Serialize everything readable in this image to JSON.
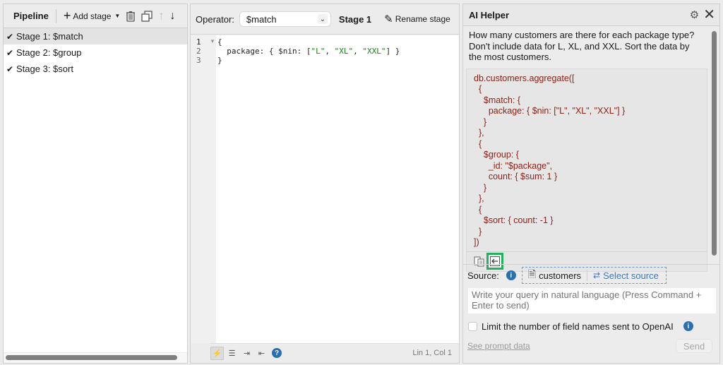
{
  "pipeline": {
    "title": "Pipeline",
    "add_stage_label": "Add stage",
    "stages": [
      {
        "label": "Stage 1: $match",
        "checked": true,
        "selected": true
      },
      {
        "label": "Stage 2: $group",
        "checked": true,
        "selected": false
      },
      {
        "label": "Stage 3: $sort",
        "checked": true,
        "selected": false
      }
    ]
  },
  "editor": {
    "operator_label": "Operator:",
    "operator_value": "$match",
    "stage_name": "Stage 1",
    "rename_label": "Rename stage",
    "line_numbers": [
      "1",
      "2",
      "3"
    ],
    "code_lines": {
      "l1": "{",
      "l2_pre": "  package: { $nin: [",
      "s1": "\"L\"",
      "c1": ", ",
      "s2": "\"XL\"",
      "c2": ", ",
      "s3": "\"XXL\"",
      "l2_post": "] }",
      "l3": "}"
    },
    "cursor_position": "Lin 1, Col 1"
  },
  "ai_helper": {
    "title": "AI Helper",
    "prompt": "How many customers are there for each package type? Don't include data for L, XL, and XXL. Sort the data by the most customers.",
    "response_code": "db.customers.aggregate([\n  {\n    $match: {\n      package: { $nin: [\"L\", \"XL\", \"XXL\"] }\n    }\n  },\n  {\n    $group: {\n      _id: \"$package\",\n      count: { $sum: 1 }\n    }\n  },\n  {\n    $sort: { count: -1 }\n  }\n])",
    "source_label": "Source:",
    "source_collection": "customers",
    "select_source_label": "Select source",
    "query_placeholder": "Write your query in natural language (Press Command + Enter to send)",
    "limit_label": "Limit the number of field names sent to OpenAI",
    "see_prompt_label": "See prompt data",
    "send_label": "Send"
  }
}
